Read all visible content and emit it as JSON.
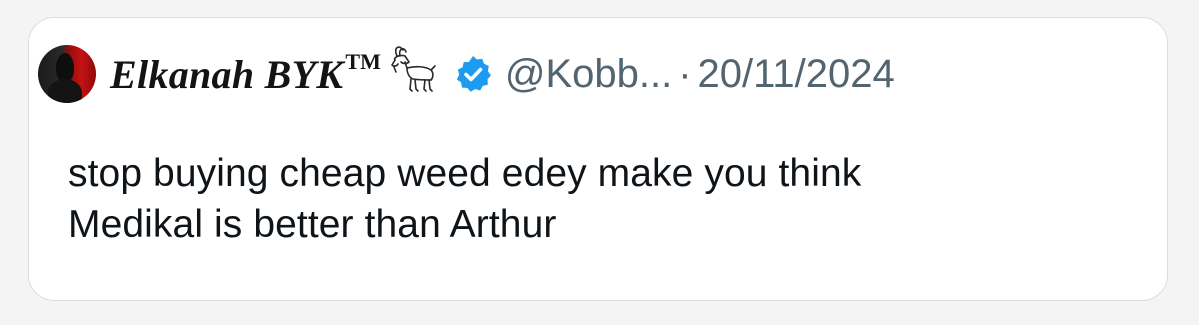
{
  "tweet": {
    "author": {
      "display_name": "Elkanah BYK",
      "trademark": "TM",
      "emoji_icon": "goat-icon",
      "verified": true,
      "verified_color": "#1d9bf0",
      "handle": "@Kobb...",
      "avatar_colors": [
        "#1a1a1a",
        "#c41212"
      ]
    },
    "separator": "·",
    "date": "20/11/2024",
    "text_lines": [
      "stop buying cheap weed edey make you think",
      "Medikal is better than Arthur"
    ]
  },
  "colors": {
    "background": "#f4f4f4",
    "card": "#ffffff",
    "border": "#dcdcdc",
    "text": "#0f1419",
    "muted": "#536471"
  }
}
